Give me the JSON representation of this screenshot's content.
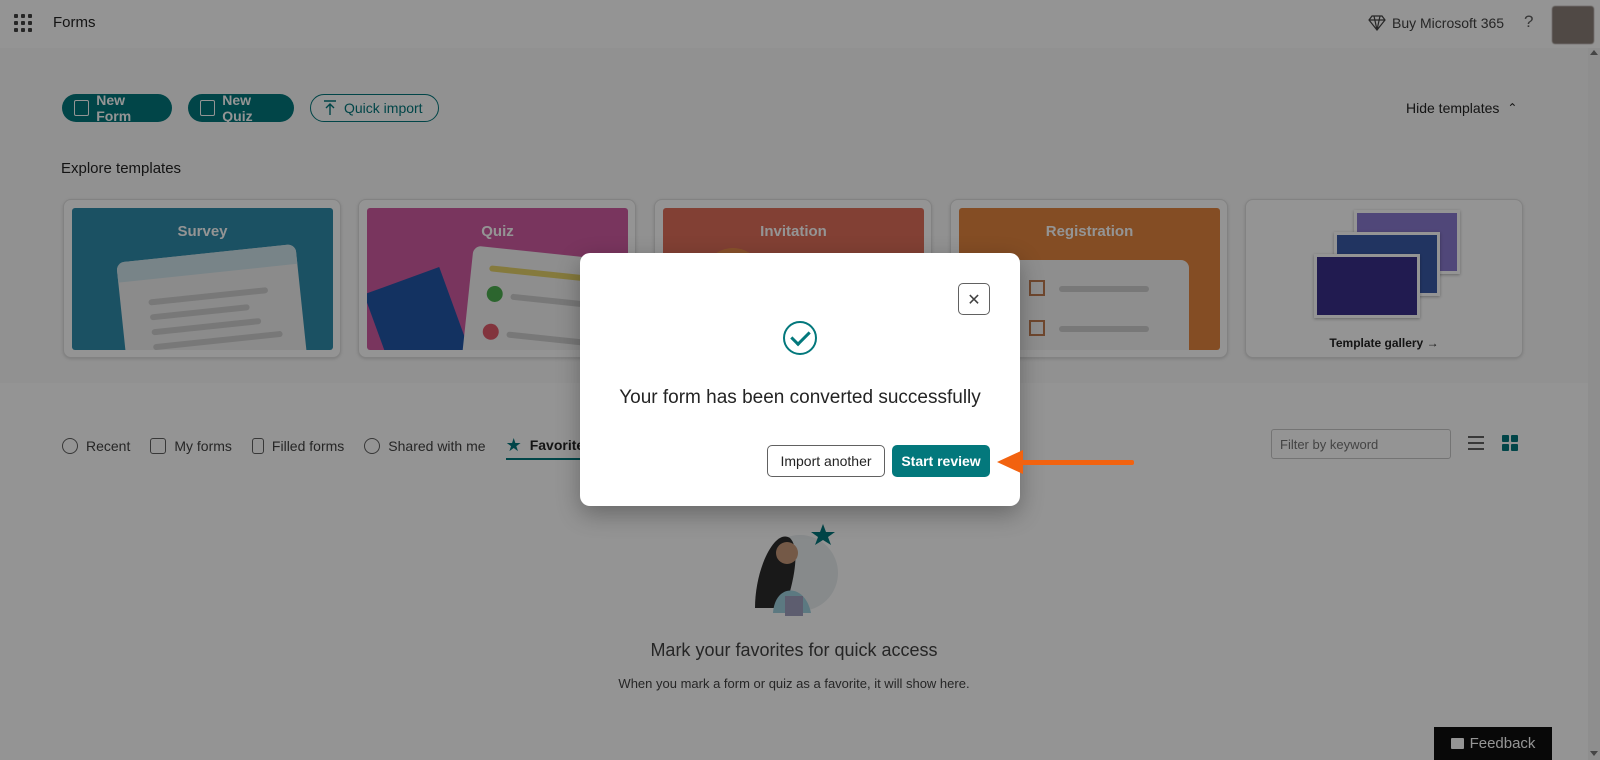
{
  "topbar": {
    "app_name": "Forms",
    "buy_label": "Buy Microsoft 365",
    "help_label": "?"
  },
  "actions": {
    "new_form": "New Form",
    "new_quiz": "New Quiz",
    "quick_import": "Quick import",
    "hide_templates": "Hide templates"
  },
  "templates": {
    "heading": "Explore templates",
    "cards": [
      {
        "title": "Survey"
      },
      {
        "title": "Quiz"
      },
      {
        "title": "Invitation"
      },
      {
        "title": "Registration"
      }
    ],
    "gallery_label": "Template gallery"
  },
  "tabs": [
    {
      "label": "Recent"
    },
    {
      "label": "My forms"
    },
    {
      "label": "Filled forms"
    },
    {
      "label": "Shared with me"
    },
    {
      "label": "Favorites"
    }
  ],
  "filter": {
    "placeholder": "Filter by keyword"
  },
  "empty_state": {
    "title": "Mark your favorites for quick access",
    "subtitle": "When you mark a form or quiz as a favorite, it will show here."
  },
  "feedback_label": "Feedback",
  "dialog": {
    "message": "Your form has been converted successfully",
    "import_another": "Import another",
    "start_review": "Start review"
  },
  "colors": {
    "accent": "#03787c",
    "arrow": "#f2620f"
  }
}
